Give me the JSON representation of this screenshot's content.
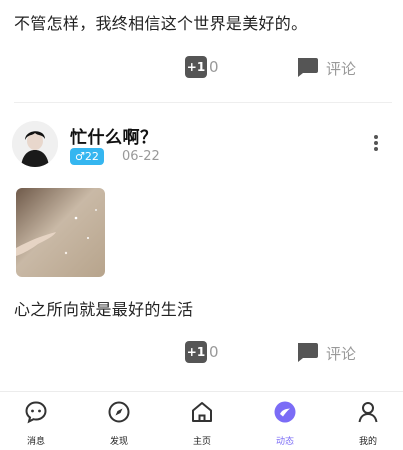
{
  "posts": [
    {
      "text": "不管怎样，我终相信这个世界是美好的。",
      "plus_icon": "+1",
      "plus_count": "0",
      "comment_label": "评论"
    },
    {
      "text": "心之所向就是最好的生活",
      "plus_icon": "+1",
      "plus_count": "0",
      "comment_label": "评论"
    }
  ],
  "user": {
    "name": "忙什么啊？",
    "gender_age": "♂22",
    "date": "06-22"
  },
  "tabs": [
    {
      "label": "消息",
      "icon": "chat-bubble-icon"
    },
    {
      "label": "发现",
      "icon": "compass-icon"
    },
    {
      "label": "主页",
      "icon": "home-icon"
    },
    {
      "label": "动态",
      "icon": "feed-icon",
      "active": true
    },
    {
      "label": "我的",
      "icon": "person-icon"
    }
  ],
  "colors": {
    "accent": "#7b6cf6",
    "badge": "#35b6f0",
    "muted": "#999999"
  }
}
